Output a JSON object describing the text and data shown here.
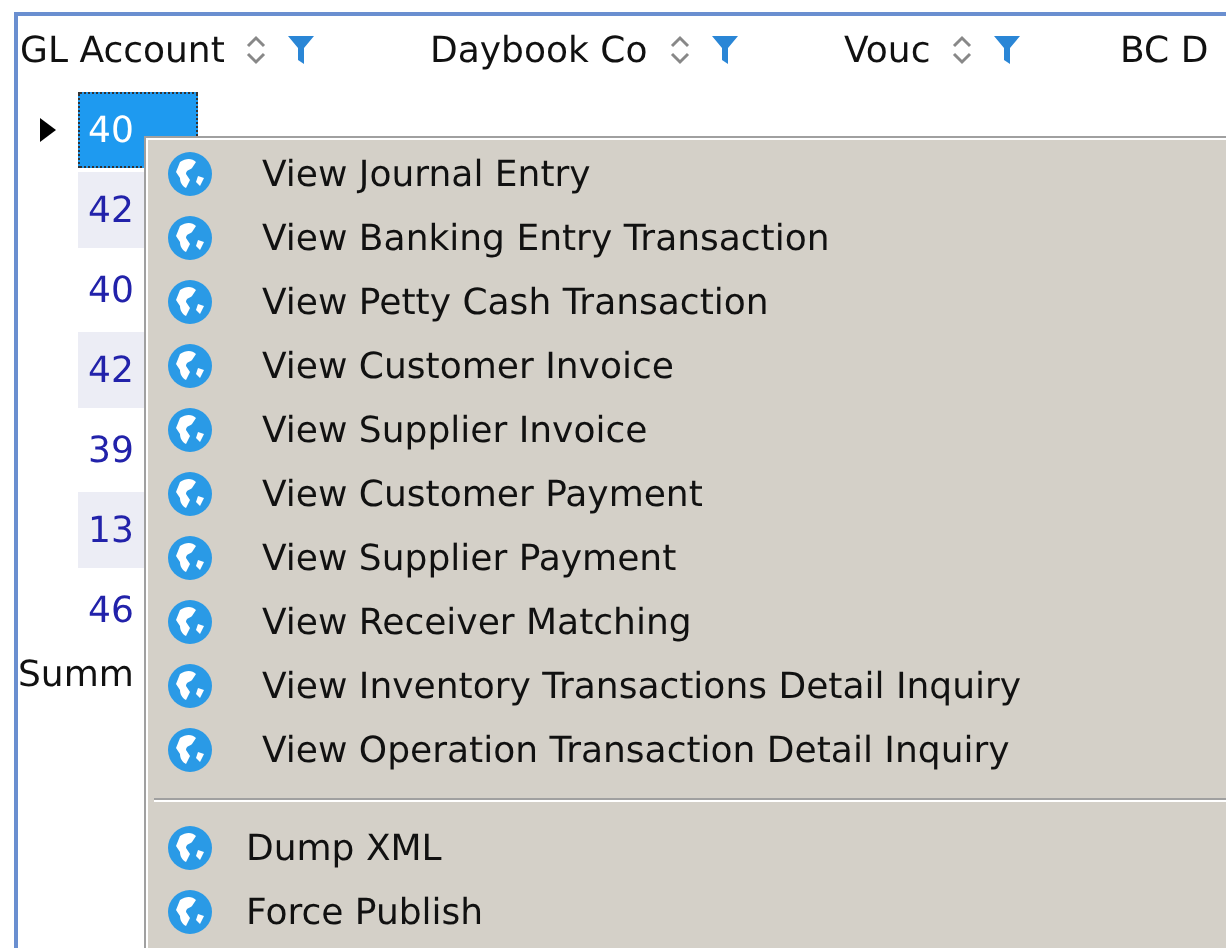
{
  "grid": {
    "columns": [
      {
        "label": "GL Account",
        "sortable": true,
        "filterable": true
      },
      {
        "label": "Daybook Co",
        "sortable": true,
        "filterable": true
      },
      {
        "label": "Vouc",
        "sortable": true,
        "filterable": true
      },
      {
        "label": "BC D",
        "sortable": false,
        "filterable": false
      }
    ],
    "rows": [
      {
        "cell": "40",
        "selected": true,
        "current": true
      },
      {
        "cell": "42",
        "selected": false,
        "current": false
      },
      {
        "cell": "40",
        "selected": false,
        "current": false
      },
      {
        "cell": "42",
        "selected": false,
        "current": false
      },
      {
        "cell": "39",
        "selected": false,
        "current": false
      },
      {
        "cell": "13",
        "selected": false,
        "current": false
      },
      {
        "cell": "46",
        "selected": false,
        "current": false
      }
    ],
    "summary": "Summ"
  },
  "context_menu": {
    "groups": [
      [
        "View Journal Entry",
        "View Banking Entry Transaction",
        "View Petty Cash Transaction",
        "View Customer Invoice",
        "View Supplier Invoice",
        "View Customer Payment",
        "View Supplier Payment",
        "View Receiver Matching",
        "View Inventory Transactions Detail Inquiry",
        "View Operation Transaction Detail Inquiry"
      ],
      [
        "Dump XML",
        "Force Publish"
      ]
    ]
  }
}
